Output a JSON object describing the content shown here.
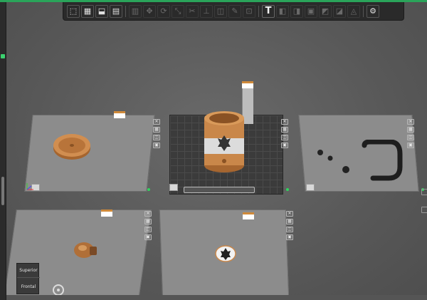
{
  "toolbar": {
    "buttons": [
      {
        "icon": "add-object-icon",
        "glyph": "⬚",
        "enabled": true
      },
      {
        "icon": "grid-arrange-icon",
        "glyph": "▦",
        "enabled": true
      },
      {
        "icon": "orient-icon",
        "glyph": "⬓",
        "enabled": true
      },
      {
        "icon": "plate-icon",
        "glyph": "▤",
        "enabled": true
      },
      {
        "icon": "layers-icon",
        "glyph": "▥",
        "enabled": false
      },
      {
        "icon": "move-icon",
        "glyph": "✥",
        "enabled": false
      },
      {
        "icon": "rotate-icon",
        "glyph": "⟳",
        "enabled": false
      },
      {
        "icon": "scale-icon",
        "glyph": "⤡",
        "enabled": false
      },
      {
        "icon": "cut-icon",
        "glyph": "✂",
        "enabled": false
      },
      {
        "icon": "support-icon",
        "glyph": "⊥",
        "enabled": false
      },
      {
        "icon": "seam-icon",
        "glyph": "◫",
        "enabled": false
      },
      {
        "icon": "paint-icon",
        "glyph": "✎",
        "enabled": false
      },
      {
        "icon": "measure-icon",
        "glyph": "⊡",
        "enabled": false
      },
      {
        "icon": "text-icon",
        "glyph": "T",
        "enabled": true
      },
      {
        "icon": "emboss-icon",
        "glyph": "◧",
        "enabled": false
      },
      {
        "icon": "split-icon",
        "glyph": "◨",
        "enabled": false
      },
      {
        "icon": "assembly-icon",
        "glyph": "▣",
        "enabled": false
      },
      {
        "icon": "boolean-icon",
        "glyph": "◩",
        "enabled": false
      },
      {
        "icon": "simplify-icon",
        "glyph": "◪",
        "enabled": false
      },
      {
        "icon": "brim-icon",
        "glyph": "◬",
        "enabled": false
      },
      {
        "icon": "settings-icon",
        "glyph": "⚙",
        "enabled": true
      }
    ]
  },
  "viewcube": {
    "top_label": "Superior",
    "front_label": "Frontal"
  },
  "colors": {
    "accent": "#2fd45e",
    "model": "#c9874a",
    "plate": "#8c8c8c",
    "active_plate": "#3b3b3b"
  }
}
